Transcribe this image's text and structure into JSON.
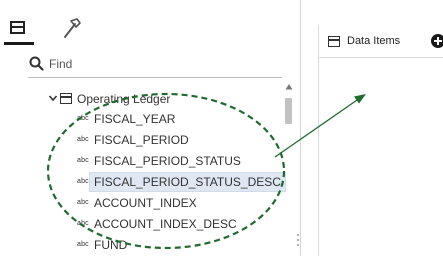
{
  "left_panel": {
    "tabs": [
      {
        "icon": "data-tab-icon",
        "active": true
      },
      {
        "icon": "hammer-icon",
        "active": false
      }
    ],
    "search": {
      "placeholder": "Find",
      "value": ""
    },
    "tree": {
      "root": {
        "label": "Operating Ledger",
        "icon": "table-icon",
        "expanded": true
      },
      "type_badge": "abc",
      "fields": [
        {
          "label": "FISCAL_YEAR",
          "selected": false
        },
        {
          "label": "FISCAL_PERIOD",
          "selected": false
        },
        {
          "label": "FISCAL_PERIOD_STATUS",
          "selected": false
        },
        {
          "label": "FISCAL_PERIOD_STATUS_DESC",
          "selected": true
        },
        {
          "label": "ACCOUNT_INDEX",
          "selected": false
        },
        {
          "label": "ACCOUNT_INDEX_DESC",
          "selected": false
        },
        {
          "label": "FUND",
          "selected": false
        }
      ]
    }
  },
  "right_panel": {
    "title": "Data Items",
    "add_icon": "plus-circle-icon"
  },
  "annotation": {
    "color": "#1e6b2d",
    "shape": "dashed-ellipse",
    "arrow": "arrow-to-right-panel"
  },
  "colors": {
    "selection_bg": "#dfe7f3",
    "text": "#333333"
  }
}
